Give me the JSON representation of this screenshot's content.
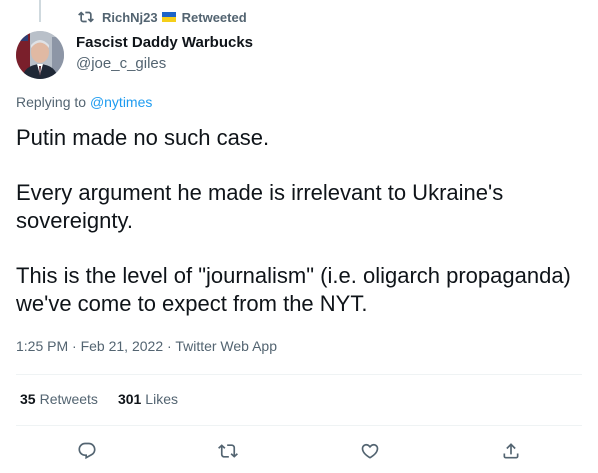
{
  "social_context": {
    "icon": "retweet-icon",
    "user": "RichNj23",
    "flag_colors": [
      "#1d64c8",
      "#f5cf1a"
    ],
    "label": "Retweeted"
  },
  "author": {
    "name": "Fascist Daddy Warbucks",
    "handle": "@joe_c_giles"
  },
  "reply": {
    "prefix": "Replying to",
    "mention": "@nytimes"
  },
  "tweet": {
    "paragraphs": [
      "Putin made no such case.",
      "Every argument he made is irrelevant to Ukraine's sovereignty.",
      "This is the level of \"journalism\" (i.e. oligarch propaganda) we've come to expect from the NYT."
    ]
  },
  "meta": {
    "time": "1:25 PM",
    "sep1": "·",
    "date": "Feb 21, 2022",
    "sep2": "·",
    "source": "Twitter Web App"
  },
  "stats": {
    "retweets_count": "35",
    "retweets_label": "Retweets",
    "likes_count": "301",
    "likes_label": "Likes"
  },
  "actions": [
    "reply-icon",
    "retweet-icon",
    "like-icon",
    "share-icon"
  ],
  "colors": {
    "accent": "#1d9bf0",
    "secondary_text": "#536471",
    "primary_text": "#0f1419"
  }
}
